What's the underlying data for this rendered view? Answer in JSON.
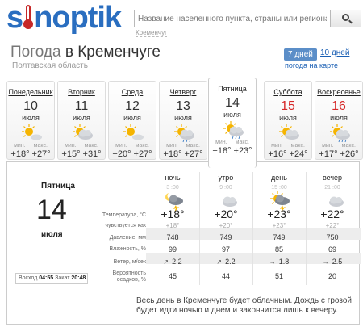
{
  "header": {
    "logo_text": "sinoptik",
    "search_placeholder": "Название населенного пункта, страны или региона",
    "search_hint": "Кременчуг"
  },
  "page": {
    "title_prefix": "Погода",
    "title_city": "в Кременчуге",
    "region": "Полтавская область",
    "period_active": "7 дней",
    "period_other": "10 дней",
    "map_link": "погода на карте"
  },
  "days": [
    {
      "name": "Понедельник",
      "num": "10",
      "month": "июля",
      "min_label": "мин.",
      "max_label": "макс.",
      "temps": "+18° +27°",
      "red": false,
      "icon": "sun-cloud-icon"
    },
    {
      "name": "Вторник",
      "num": "11",
      "month": "июля",
      "min_label": "мин.",
      "max_label": "макс.",
      "temps": "+15° +31°",
      "red": false,
      "icon": "partly-cloudy-icon"
    },
    {
      "name": "Среда",
      "num": "12",
      "month": "июля",
      "min_label": "мин.",
      "max_label": "макс.",
      "temps": "+20° +27°",
      "red": false,
      "icon": "sun-cloud-icon"
    },
    {
      "name": "Четверг",
      "num": "13",
      "month": "июля",
      "min_label": "мин.",
      "max_label": "макс.",
      "temps": "+18° +27°",
      "red": false,
      "icon": "cloud-rain-icon"
    },
    {
      "name": "Пятница",
      "num": "14",
      "month": "июля",
      "min_label": "мин.",
      "max_label": "макс.",
      "temps": "+18° +23°",
      "red": false,
      "icon": "cloud-rain-icon"
    },
    {
      "name": "Суббота",
      "num": "15",
      "month": "июля",
      "min_label": "мин.",
      "max_label": "макс.",
      "temps": "+16° +24°",
      "red": true,
      "icon": "partly-cloudy-icon"
    },
    {
      "name": "Воскресенье",
      "num": "16",
      "month": "июля",
      "min_label": "мин.",
      "max_label": "макс.",
      "temps": "+17° +26°",
      "red": true,
      "icon": "cloud-rain-icon"
    }
  ],
  "detail": {
    "day_name": "Пятница",
    "day_num": "14",
    "month": "июля",
    "sunrise_label": "Восход",
    "sunrise": "04:55",
    "sunset_label": "Закат",
    "sunset": "20:48",
    "row_labels": {
      "temp": "Температура, °C",
      "feels": "чувствуется как",
      "pressure": "Давление, мм",
      "humidity": "Влажность, %",
      "wind": "Ветер, м/сек",
      "precip1": "Вероятность",
      "precip2": "осадков, %"
    },
    "columns": [
      {
        "name": "ночь",
        "time": "3 :00",
        "temp": "+18°",
        "feels": "+18°",
        "pressure": "748",
        "humidity": "99",
        "wind": "2.2",
        "wind_arrow": "↗",
        "precip": "45",
        "icon": "night-storm-icon"
      },
      {
        "name": "утро",
        "time": "9 :00",
        "temp": "+20°",
        "feels": "+20°",
        "pressure": "749",
        "humidity": "97",
        "wind": "2.2",
        "wind_arrow": "↗",
        "precip": "44",
        "icon": "cloud-icon"
      },
      {
        "name": "день",
        "time": "15 :00",
        "temp": "+23°",
        "feels": "+23°",
        "pressure": "749",
        "humidity": "85",
        "wind": "1.8",
        "wind_arrow": "→",
        "precip": "51",
        "icon": "sun-storm-icon"
      },
      {
        "name": "вечер",
        "time": "21 :00",
        "temp": "+22°",
        "feels": "+22°",
        "pressure": "750",
        "humidity": "69",
        "wind": "2.5",
        "wind_arrow": "→",
        "precip": "20",
        "icon": "cloud-icon"
      }
    ],
    "description": "Весь день в Кременчуге будет облачным. Дождь с грозой будет идти ночью и днем и закончится лишь к вечеру."
  }
}
